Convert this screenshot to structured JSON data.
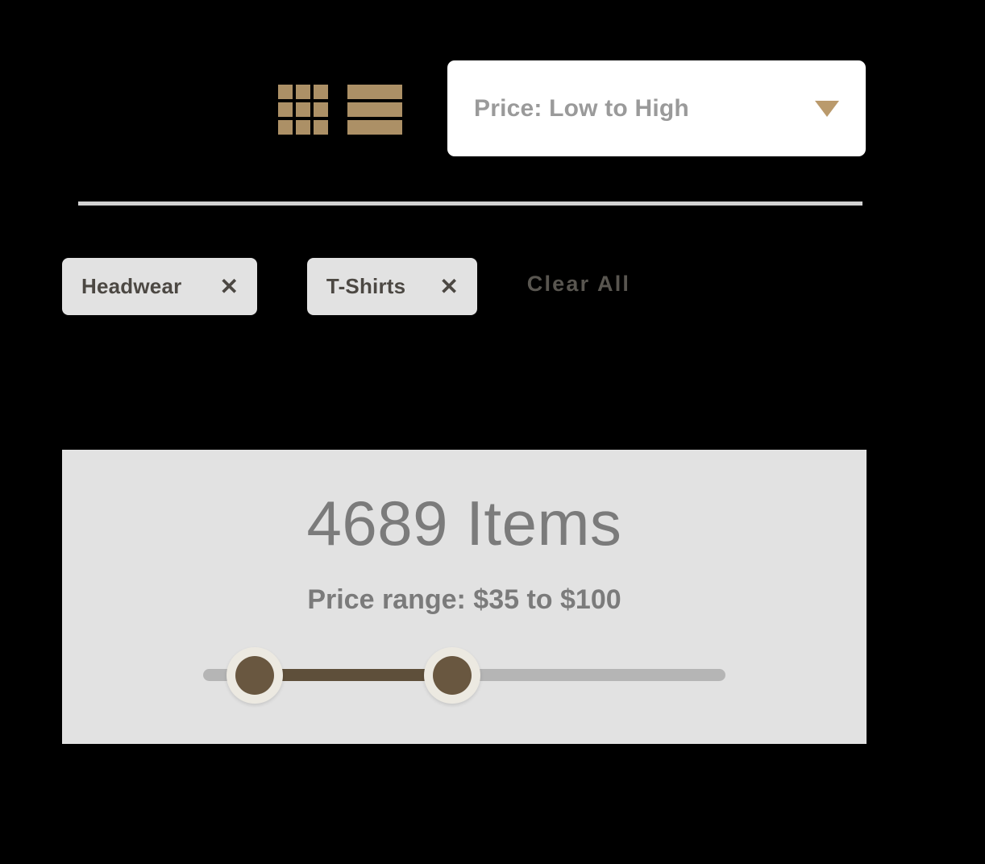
{
  "toolbar": {
    "view_modes": [
      {
        "name": "grid-view",
        "icon": "grid-icon",
        "cells": 9
      },
      {
        "name": "list-view",
        "icon": "list-icon",
        "rows": 3
      }
    ],
    "sort": {
      "selected": "Price: Low to High",
      "caret_icon": "chevron-down-icon"
    },
    "accent_color": "#ac9066"
  },
  "filters": {
    "chips": [
      {
        "label": "Headwear",
        "close_icon": "✕"
      },
      {
        "label": "T-Shirts",
        "close_icon": "✕"
      }
    ],
    "clear_all_label": "Clear All"
  },
  "results": {
    "item_count_text": "4689 Items",
    "item_count": 4689,
    "price_range_label": "Price range: $35 to $100",
    "price_min": 35,
    "price_max": 100,
    "panel_color": "#e2e2e2"
  },
  "slider": {
    "track_color": "#b5b5b5",
    "fill_color": "#5e4f3a",
    "thumb_ring_color": "#ece9e1",
    "thumb_color": "#695740",
    "min_thumb_name": "price-min-handle",
    "max_thumb_name": "price-max-handle"
  }
}
